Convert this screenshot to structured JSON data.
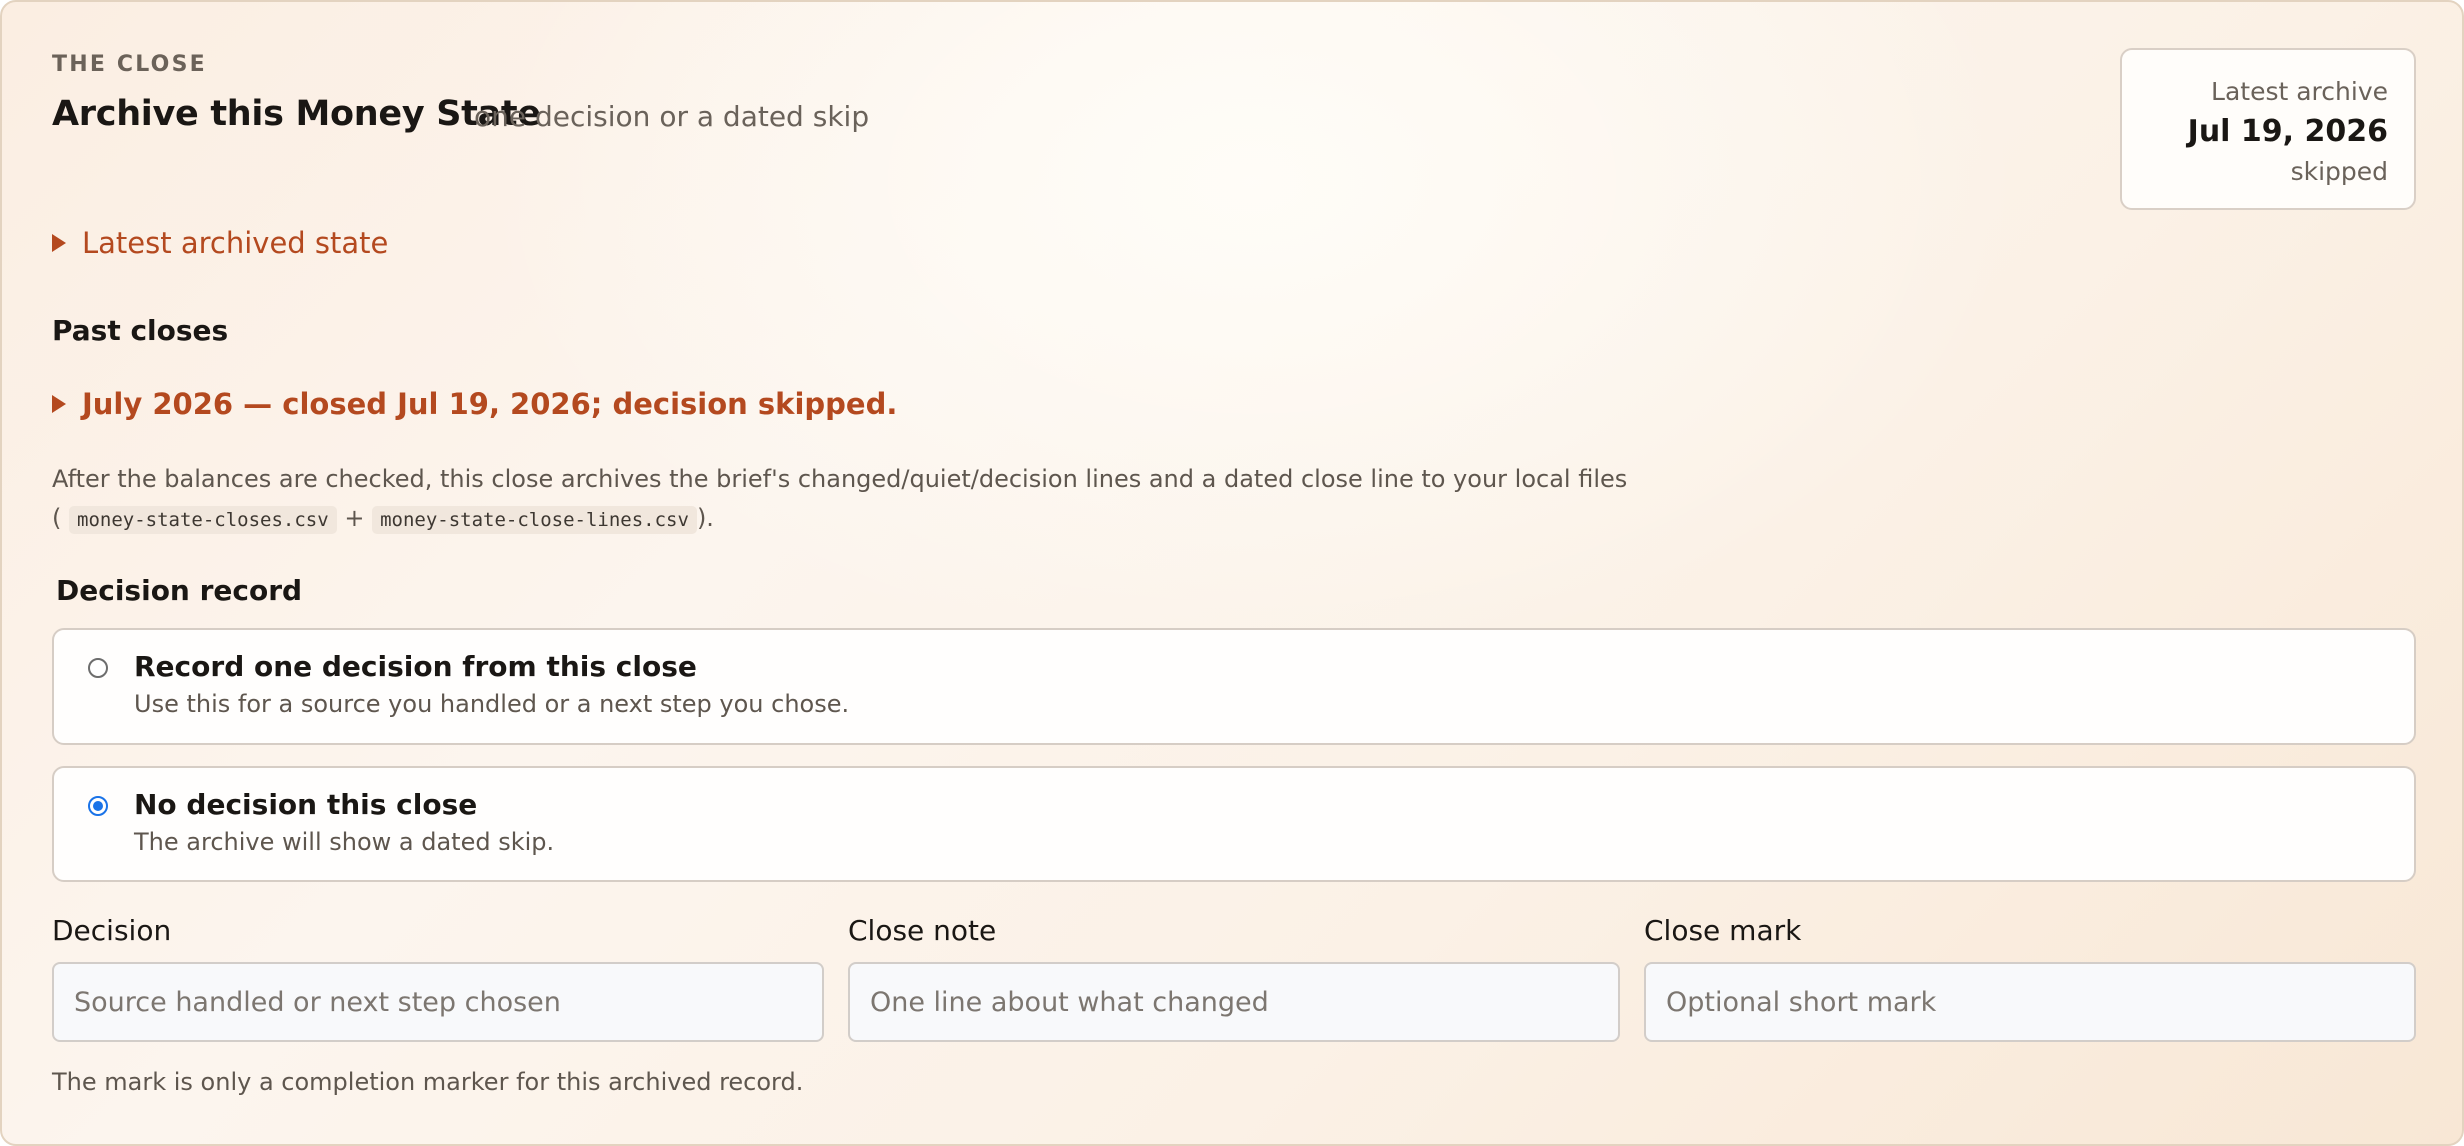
{
  "header": {
    "eyebrow": "THE CLOSE",
    "title": "Archive this Money State",
    "subtitle": "one decision or a dated skip"
  },
  "latest_archive": {
    "label": "Latest archive",
    "date": "Jul 19, 2026",
    "status": "skipped"
  },
  "latest_archived_state": {
    "label": "Latest archived state",
    "icon": "disclosure-triangle-icon"
  },
  "past_closes": {
    "heading": "Past closes",
    "items": [
      {
        "label": "July 2026 — closed Jul 19, 2026; decision skipped."
      }
    ]
  },
  "explanation": {
    "text": "After the balances are checked, this close archives the brief's changed/quiet/decision lines and a dated close line to your local files",
    "open_paren": "(",
    "file_1": "money-state-closes.csv",
    "plus": "+",
    "file_2": "money-state-close-lines.csv",
    "close_paren": ")."
  },
  "decision_record": {
    "heading": "Decision record",
    "options": [
      {
        "title": "Record one decision from this close",
        "description": "Use this for a source you handled or a next step you chose.",
        "selected": false
      },
      {
        "title": "No decision this close",
        "description": "The archive will show a dated skip.",
        "selected": true
      }
    ]
  },
  "fields": {
    "decision": {
      "label": "Decision",
      "placeholder": "Source handled or next step chosen",
      "value": ""
    },
    "close_note": {
      "label": "Close note",
      "placeholder": "One line about what changed",
      "value": ""
    },
    "close_mark": {
      "label": "Close mark",
      "placeholder": "Optional short mark",
      "value": ""
    }
  },
  "footnote": "The mark is only a completion marker for this archived record.",
  "colors": {
    "accent": "#b4491f",
    "radio_selected": "#1a73e8",
    "text_primary": "#1a1714",
    "text_muted": "#5e564e"
  }
}
